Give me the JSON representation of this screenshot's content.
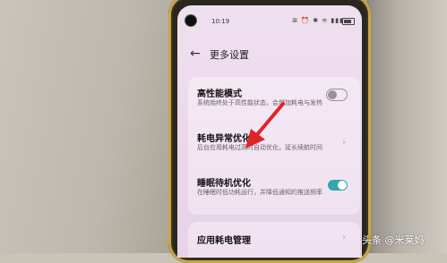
{
  "status_bar": {
    "time": "10:19",
    "icons": "⊞ ⏰ ✱ ≋ ▮▮▮"
  },
  "header": {
    "back_glyph": "←",
    "title": "更多设置"
  },
  "settings": {
    "items": [
      {
        "title": "高性能模式",
        "description": "系统始终处于高性能状态，会增加耗电与发热",
        "control": "toggle",
        "enabled": false
      },
      {
        "title": "耗电异常优化",
        "description": "后台应用耗电过高时自动优化，延长续航时间",
        "control": "chevron"
      },
      {
        "title": "睡眠待机优化",
        "description": "在睡眠时低功耗运行，并降低通知的推送频率",
        "control": "toggle",
        "enabled": true
      },
      {
        "title": "应用耗电管理",
        "description": "",
        "control": "chevron"
      }
    ]
  },
  "chevron_glyph": "›",
  "colors": {
    "toggle_on": "#2fa7ad",
    "arrow": "#e0242a"
  },
  "watermark": "头条 @米莱妈"
}
